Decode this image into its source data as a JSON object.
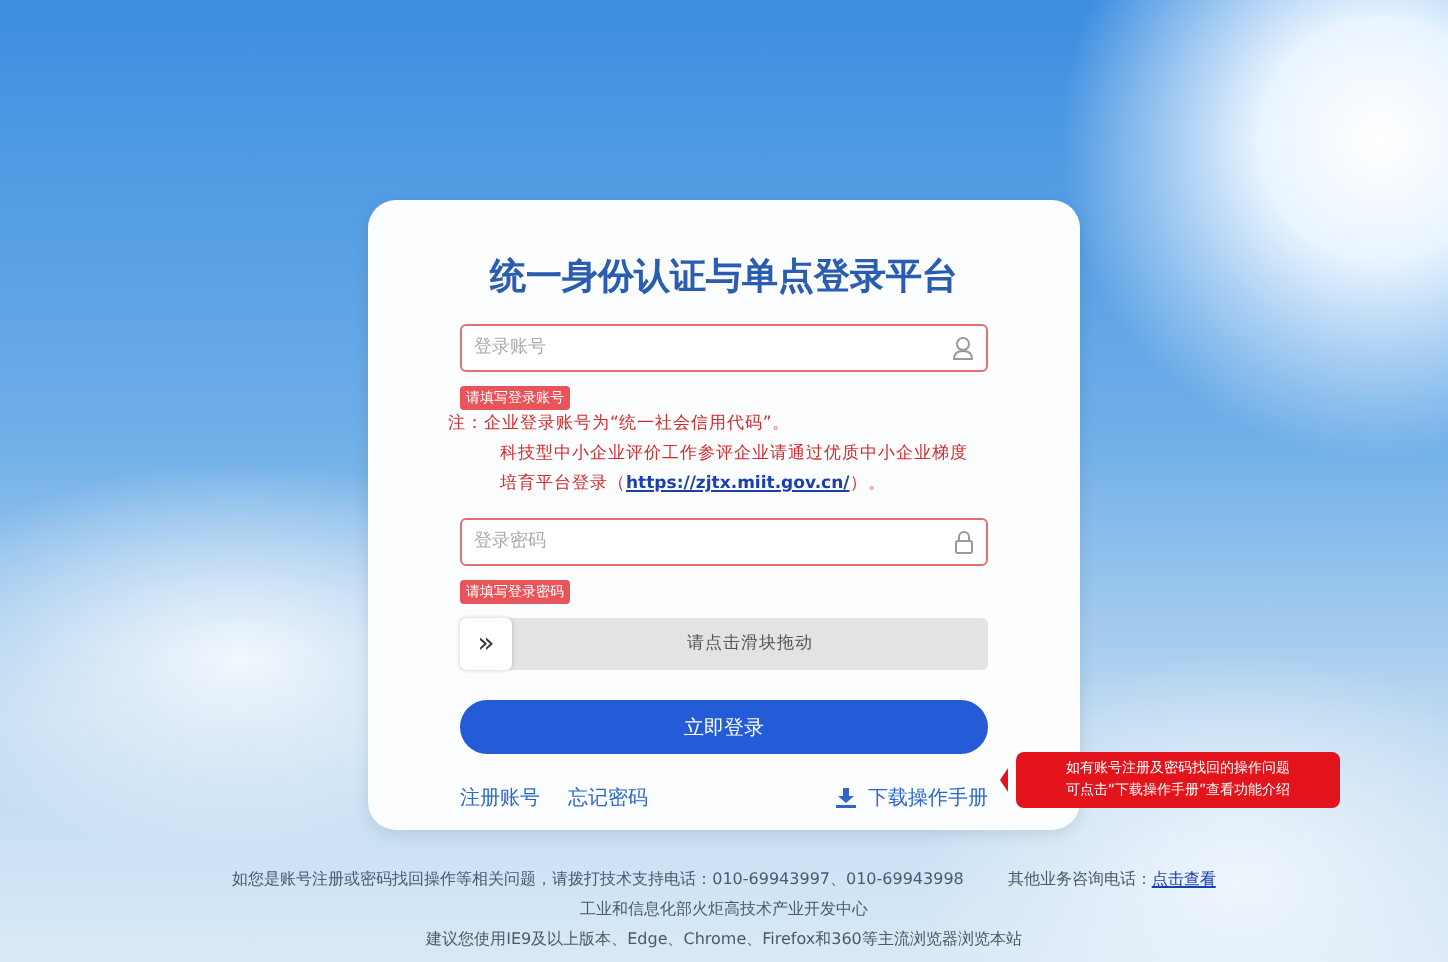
{
  "title": "统一身份认证与单点登录平台",
  "account_field": {
    "placeholder": "登录账号",
    "invalid": true,
    "error": "请填写登录账号"
  },
  "notes": [
    {
      "kind": "plain",
      "text": "注：企业登录账号为“统一社会信用代码”。"
    },
    {
      "kind": "link",
      "text": "科技型中小企业评价工作参评企业请通过优质中小企业梯度培育平台登录（",
      "link": "https://zjtx.miit.gov.cn/",
      "after": "）。"
    }
  ],
  "password_field": {
    "placeholder": "登录密码",
    "invalid": true,
    "error": "请填写登录密码"
  },
  "slider": {
    "handle": "»",
    "label": "请点击滑块拖动"
  },
  "login_button": "立即登录",
  "links": [
    "注册账号",
    "忘记密码"
  ],
  "download_link": "下载操作手册",
  "callout": [
    "如有账号注册及密码找回的操作问题",
    "可点击“下载操作手册”查看功能介绍"
  ],
  "footer": {
    "support": "如您是账号注册或密码找回操作等相关问题，请拨打技术支持电话：010-69943997、010-69943998",
    "other_label": "其他业务咨询电话：",
    "other_link": "点击查看",
    "org": "工业和信息化部火炬高技术产业开发中心",
    "browser": "建议您使用IE9及以上版本、Edge、Chrome、Firefox和360等主流浏览器浏览本站"
  }
}
